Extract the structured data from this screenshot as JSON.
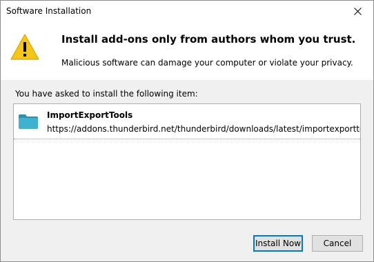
{
  "window": {
    "title": "Software Installation",
    "close_icon": "close-icon"
  },
  "header": {
    "icon": "warning-icon",
    "heading": "Install add-ons only from authors whom you trust.",
    "subtext": "Malicious software can damage your computer or violate your privacy."
  },
  "main": {
    "intro": "You have asked to install the following item:",
    "items": [
      {
        "icon": "folder-icon",
        "name": "ImportExportTools",
        "url": "https://addons.thunderbird.net/thunderbird/downloads/latest/importexporttools/ad"
      }
    ]
  },
  "buttons": {
    "install_label": "Install Now",
    "cancel_label": "Cancel"
  },
  "colors": {
    "accent": "#0078d7",
    "warning_yellow": "#f6c519",
    "folder_teal": "#39a8c4"
  }
}
